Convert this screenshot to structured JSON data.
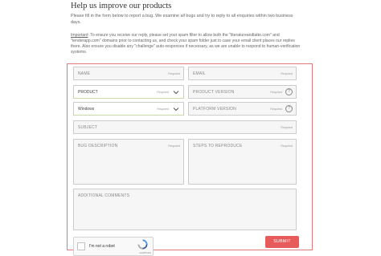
{
  "page": {
    "title": "Help us improve our products",
    "intro": "Please fill in the form below to report a bug. We examine all bugs and try to reply to all enquiries within two business days.",
    "notice_label": "Important",
    "notice_text": ": To ensure you receive our reply, please set your spam filter to allow both the \"literatureandlatte.com\" and \"tenderapp.com\" domains prior to contacting us, and check your spam folder just in case your email client places our replies there. Also ensure you disable any \"challenge\" auto-responses if necessary, as we are unable to respond to human-verification systems."
  },
  "form": {
    "name": {
      "placeholder": "NAME",
      "required": "Required"
    },
    "email": {
      "placeholder": "EMAIL",
      "required": "Required"
    },
    "product": {
      "value": "PRODUCT",
      "required": "Required"
    },
    "product_version": {
      "placeholder": "PRODUCT VERSION",
      "required": "Required"
    },
    "platform_select": {
      "value": "Windows",
      "required": "Required"
    },
    "platform_version": {
      "placeholder": "PLATFORM VERSION",
      "required": "Required"
    },
    "subject": {
      "placeholder": "SUBJECT",
      "required": "Required"
    },
    "bug_description": {
      "placeholder": "BUG DESCRIPTION",
      "required": "Required"
    },
    "steps": {
      "placeholder": "STEPS TO REPRODUCE",
      "required": "Required"
    },
    "comments": {
      "placeholder": "ADDITIONAL COMMENTS"
    },
    "captcha": {
      "label": "I'm not a robot",
      "brand": "reCAPTCHA"
    },
    "submit_label": "SUBMIT"
  },
  "colors": {
    "accent": "#e75b5b",
    "form_border": "#e07a7a",
    "field_bg": "#f6f6f6"
  },
  "icons": [
    "chevron-down-icon",
    "question-icon",
    "recaptcha-icon",
    "checkbox-icon"
  ]
}
